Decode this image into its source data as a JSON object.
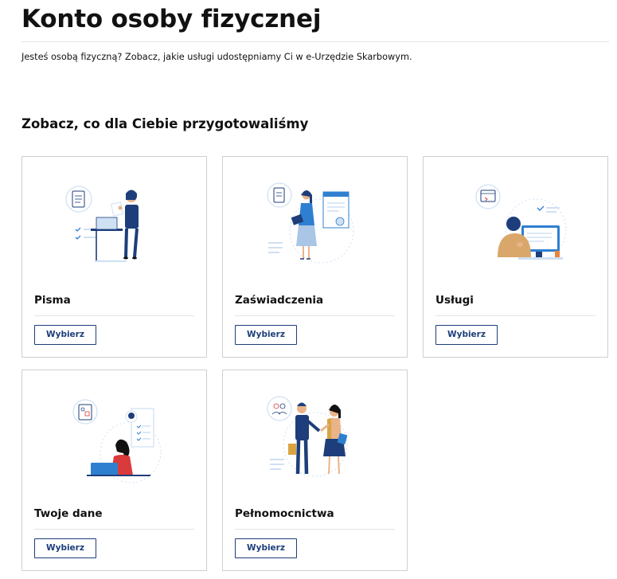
{
  "page": {
    "title": "Konto osoby fizycznej",
    "intro": "Jesteś osobą fizyczną? Zobacz, jakie usługi udostępniamy Ci w e-Urzędzie Skarbowym.",
    "section_title": "Zobacz, co dla Ciebie przygotowaliśmy"
  },
  "cards": [
    {
      "title": "Pisma",
      "button": "Wybierz",
      "illustration": "man-with-documents-at-desk"
    },
    {
      "title": "Zaświadczenia",
      "button": "Wybierz",
      "illustration": "woman-with-certificate"
    },
    {
      "title": "Usługi",
      "button": "Wybierz",
      "illustration": "person-at-computer"
    },
    {
      "title": "Twoje dane",
      "button": "Wybierz",
      "illustration": "woman-with-laptop-profile"
    },
    {
      "title": "Pełnomocnictwa",
      "button": "Wybierz",
      "illustration": "handshake-two-people"
    }
  ],
  "colors": {
    "navy": "#1d3e7a",
    "accent_blue": "#2f7fd1",
    "light_blue": "#cfe0f3",
    "skin": "#e9b48a",
    "red": "#d93a3a",
    "mustard": "#d9a441"
  }
}
